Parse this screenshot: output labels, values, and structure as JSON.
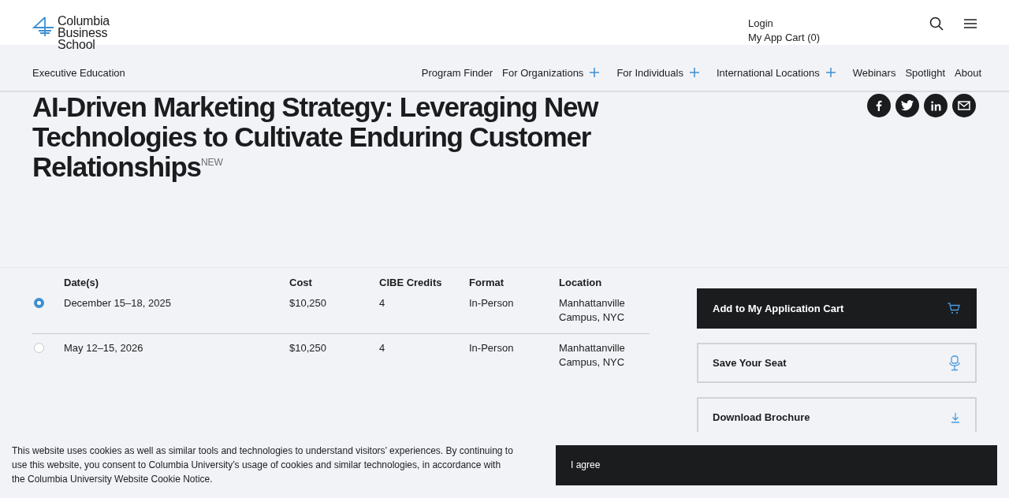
{
  "logo": {
    "lines": [
      "Columbia",
      "Business",
      "School"
    ]
  },
  "utility_links": [
    "Login",
    "My App Cart (0)"
  ],
  "nav": {
    "section": "Executive Education",
    "items": [
      {
        "label": "Program Finder",
        "has_menu": false
      },
      {
        "label": "For Organizations",
        "has_menu": true
      },
      {
        "label": "For Individuals",
        "has_menu": true
      },
      {
        "label": "International Locations",
        "has_menu": true
      },
      {
        "label": "Webinars",
        "has_menu": false
      },
      {
        "label": "Spotlight",
        "has_menu": false
      },
      {
        "label": "About",
        "has_menu": false
      }
    ]
  },
  "title": "AI-Driven Marketing Strategy: Leveraging New Technologies to Cultivate Enduring Customer Relationships$^{NEW}$",
  "share": [
    {
      "kind": "facebook"
    },
    {
      "kind": "twitter"
    },
    {
      "kind": "linkedin"
    },
    {
      "kind": "email"
    }
  ],
  "sessions": {
    "columns": [
      "Date(s)",
      "Cost",
      "CIBE Credits",
      "Format",
      "Location"
    ],
    "rows": [
      {
        "selected": true,
        "cells": [
          "December 15–18, 2025",
          "$10,250",
          "4",
          "In-Person",
          "Manhattanville Campus, NYC"
        ]
      },
      {
        "selected": false,
        "cells": [
          "May 12–15, 2026",
          "$10,250",
          "4",
          "In-Person",
          "Manhattanville Campus, NYC"
        ]
      }
    ]
  },
  "actions": [
    {
      "label": "Add to My Application Cart",
      "kind": "cart",
      "primary": true
    },
    {
      "label": "Save Your Seat",
      "kind": "seat",
      "primary": false
    },
    {
      "label": "Download Brochure",
      "kind": "download",
      "primary": false
    }
  ],
  "cookie": {
    "text": "This website uses cookies as well as similar tools and technologies to understand visitors’ experiences. By continuing to use this website, you consent to Columbia University’s usage of cookies and similar technologies, in accordance with the Columbia University Website Cookie Notice.",
    "button": "I agree"
  }
}
